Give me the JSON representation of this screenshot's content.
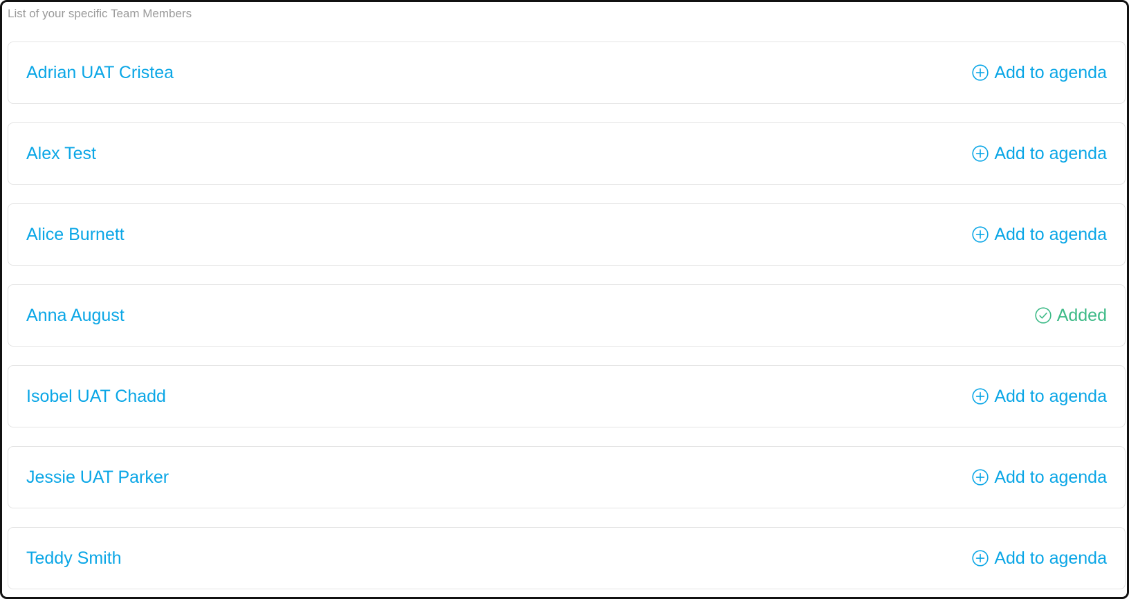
{
  "caption": "List of your specific Team Members",
  "colors": {
    "link": "#0aa6e6",
    "added": "#3dba87",
    "caption": "#9a9a9a",
    "card_border": "#e4e4e4"
  },
  "members": [
    {
      "name": "Adrian UAT Cristea",
      "action_label": "Add to agenda",
      "status": "add",
      "icon": "plus-circle-icon"
    },
    {
      "name": "Alex Test",
      "action_label": "Add to agenda",
      "status": "add",
      "icon": "plus-circle-icon"
    },
    {
      "name": "Alice Burnett",
      "action_label": "Add to agenda",
      "status": "add",
      "icon": "plus-circle-icon"
    },
    {
      "name": "Anna August",
      "action_label": "Added",
      "status": "added",
      "icon": "check-circle-icon"
    },
    {
      "name": "Isobel UAT Chadd",
      "action_label": "Add to agenda",
      "status": "add",
      "icon": "plus-circle-icon"
    },
    {
      "name": "Jessie UAT Parker",
      "action_label": "Add to agenda",
      "status": "add",
      "icon": "plus-circle-icon"
    },
    {
      "name": "Teddy Smith",
      "action_label": "Add to agenda",
      "status": "add",
      "icon": "plus-circle-icon"
    }
  ]
}
